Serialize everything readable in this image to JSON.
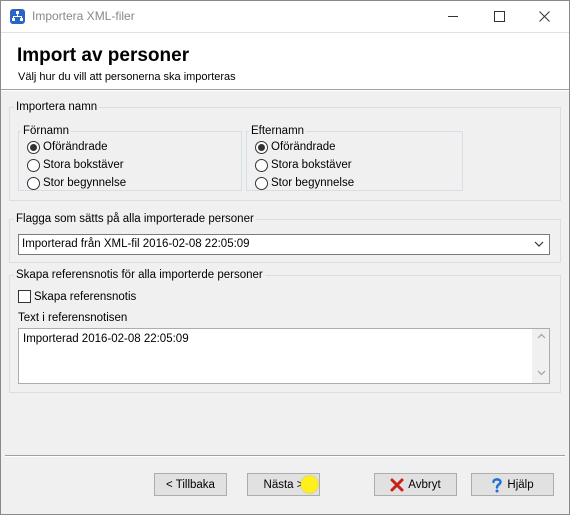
{
  "window": {
    "title": "Importera XML-filer"
  },
  "header": {
    "title": "Import av personer",
    "subtitle": "Välj hur du vill att  personerna ska importeras"
  },
  "import_names": {
    "group_label": "Importera namn",
    "first_name": {
      "label": "Förnamn",
      "options": [
        "Oförändrade",
        "Stora bokstäver",
        "Stor begynnelse"
      ],
      "selected": "Oförändrade"
    },
    "last_name": {
      "label": "Efternamn",
      "options": [
        "Oförändrade",
        "Stora bokstäver",
        "Stor begynnelse"
      ],
      "selected": "Oförändrade"
    }
  },
  "flag": {
    "group_label": "Flagga som sätts på alla importerade personer",
    "selected_value": "Importerad från XML-fil 2016-02-08 22:05:09"
  },
  "reference_note": {
    "group_label": "Skapa referensnotis för alla importerde personer",
    "checkbox_label": "Skapa referensnotis",
    "checked": false,
    "text_label": "Text i referensnotisen",
    "text_value": "Importerad 2016-02-08 22:05:09"
  },
  "buttons": {
    "back": "< Tillbaka",
    "next": "Nästa >",
    "cancel": "Avbryt",
    "help": "Hjälp"
  },
  "icons": {
    "app": "family-tree-app-icon",
    "minimize": "minimize-icon",
    "maximize": "maximize-icon",
    "close": "close-icon",
    "cancel": "red-x-icon",
    "help": "question-mark-icon",
    "dropdown": "chevron-down-icon"
  },
  "colors": {
    "app_icon": "#2b64c8",
    "cancel_icon": "#c8201a",
    "help_icon": "#1f6fd6",
    "cursor_highlight": "#ffef1a"
  }
}
